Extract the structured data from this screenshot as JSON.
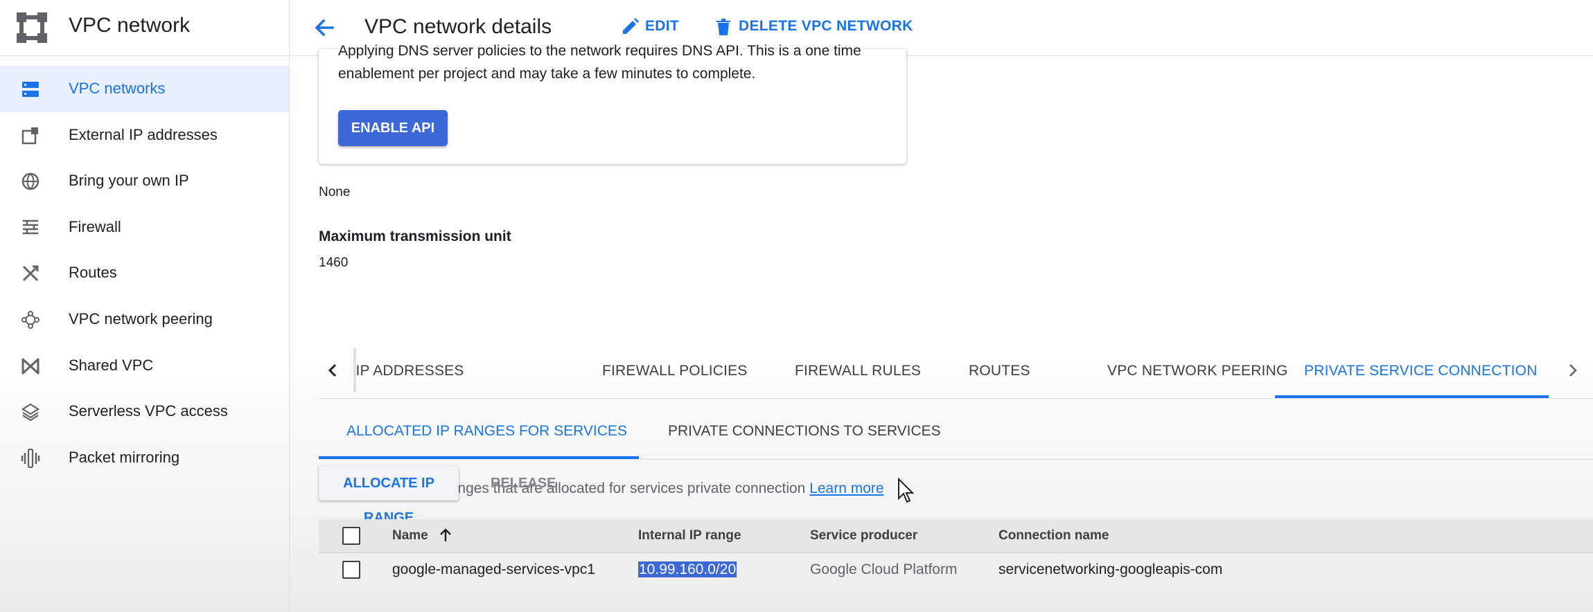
{
  "sidebar": {
    "title": "VPC network",
    "items": [
      {
        "label": "VPC networks",
        "icon": "vpc-networks-icon",
        "active": true
      },
      {
        "label": "External IP addresses",
        "icon": "external-ip-icon"
      },
      {
        "label": "Bring your own IP",
        "icon": "globe-icon"
      },
      {
        "label": "Firewall",
        "icon": "firewall-icon"
      },
      {
        "label": "Routes",
        "icon": "routes-icon"
      },
      {
        "label": "VPC network peering",
        "icon": "peering-icon"
      },
      {
        "label": "Shared VPC",
        "icon": "shared-vpc-icon"
      },
      {
        "label": "Serverless VPC access",
        "icon": "serverless-icon"
      },
      {
        "label": "Packet mirroring",
        "icon": "packet-mirroring-icon"
      }
    ]
  },
  "header": {
    "title": "VPC network details",
    "edit_label": "EDIT",
    "delete_label": "DELETE VPC NETWORK"
  },
  "dns_card": {
    "text": "Applying DNS server policies to the network requires DNS API. This is a one time enablement per project and may take a few minutes to complete.",
    "button_label": "ENABLE API"
  },
  "dns_policy_value": "None",
  "mtu": {
    "label": "Maximum transmission unit",
    "value": "1460"
  },
  "tabs": [
    {
      "label": "STATIC INTERNAL IP ADDRESSES"
    },
    {
      "label": "FIREWALL POLICIES"
    },
    {
      "label": "FIREWALL RULES"
    },
    {
      "label": "ROUTES"
    },
    {
      "label": "VPC NETWORK PEERING"
    },
    {
      "label": "PRIVATE SERVICE CONNECTION",
      "active": true
    }
  ],
  "subtabs": [
    {
      "label": "ALLOCATED IP RANGES FOR SERVICES",
      "active": true
    },
    {
      "label": "PRIVATE CONNECTIONS TO SERVICES"
    }
  ],
  "description": {
    "text": "Internal IP address ranges that are allocated for services private connection",
    "link": "Learn more"
  },
  "actions": {
    "allocate": "ALLOCATE IP RANGE",
    "release": "RELEASE"
  },
  "table": {
    "columns": [
      "Name",
      "Internal IP range",
      "Service producer",
      "Connection name"
    ],
    "sort_column": "Name",
    "rows": [
      {
        "name": "google-managed-services-vpc1",
        "ip_range": "10.99.160.0/20",
        "producer": "Google Cloud Platform",
        "connection": "servicenetworking-googleapis-com"
      }
    ]
  },
  "colors": {
    "accent": "#1a73e8",
    "button": "#3b68d6",
    "active_bg": "#e8f0fe"
  }
}
